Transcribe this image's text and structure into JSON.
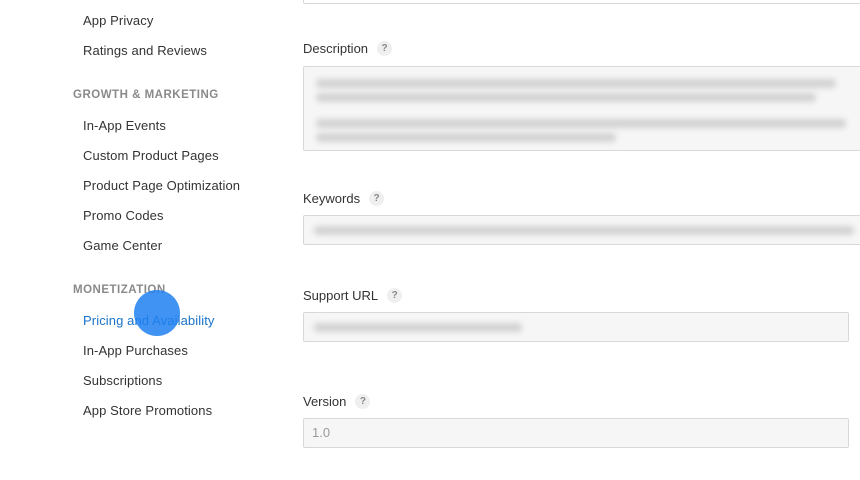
{
  "sidebar": {
    "items_top": [
      {
        "label": "App Privacy"
      },
      {
        "label": "Ratings and Reviews"
      }
    ],
    "growth_header": "GROWTH & MARKETING",
    "growth_items": [
      {
        "label": "In-App Events"
      },
      {
        "label": "Custom Product Pages"
      },
      {
        "label": "Product Page Optimization"
      },
      {
        "label": "Promo Codes"
      },
      {
        "label": "Game Center"
      }
    ],
    "monetization_header": "MONETIZATION",
    "monetization_items": [
      {
        "label": "Pricing and Availability",
        "active": true
      },
      {
        "label": "In-App Purchases"
      },
      {
        "label": "Subscriptions"
      },
      {
        "label": "App Store Promotions"
      }
    ]
  },
  "form": {
    "description_label": "Description",
    "keywords_label": "Keywords",
    "support_url_label": "Support URL",
    "version_label": "Version",
    "version_value": "1.0",
    "help_glyph": "?"
  },
  "colors": {
    "accent": "#1a73c8",
    "cursor_highlight": "#1e80f0"
  }
}
